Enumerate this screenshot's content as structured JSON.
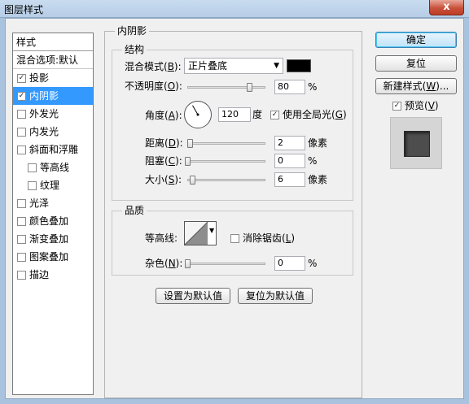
{
  "window": {
    "title": "图层样式",
    "close_label": "x"
  },
  "stylelist": {
    "header": "样式",
    "blend_options": "混合选项:默认",
    "items": [
      {
        "label": "投影",
        "checked": true,
        "selected": false,
        "sub": false
      },
      {
        "label": "内阴影",
        "checked": true,
        "selected": true,
        "sub": false
      },
      {
        "label": "外发光",
        "checked": false,
        "selected": false,
        "sub": false
      },
      {
        "label": "内发光",
        "checked": false,
        "selected": false,
        "sub": false
      },
      {
        "label": "斜面和浮雕",
        "checked": false,
        "selected": false,
        "sub": false
      },
      {
        "label": "等高线",
        "checked": false,
        "selected": false,
        "sub": true
      },
      {
        "label": "纹理",
        "checked": false,
        "selected": false,
        "sub": true
      },
      {
        "label": "光泽",
        "checked": false,
        "selected": false,
        "sub": false
      },
      {
        "label": "颜色叠加",
        "checked": false,
        "selected": false,
        "sub": false
      },
      {
        "label": "渐变叠加",
        "checked": false,
        "selected": false,
        "sub": false
      },
      {
        "label": "图案叠加",
        "checked": false,
        "selected": false,
        "sub": false
      },
      {
        "label": "描边",
        "checked": false,
        "selected": false,
        "sub": false
      }
    ]
  },
  "panel": {
    "title": "内阴影",
    "structure": {
      "title": "结构",
      "blend_mode_label": "混合模式(",
      "blend_mode_key": "B",
      "blend_mode_value": "正片叠底",
      "blend_color": "#000000",
      "opacity_label": "不透明度(",
      "opacity_key": "O",
      "opacity_value": "80",
      "opacity_unit": "%",
      "opacity_level": 0.8,
      "angle_label": "角度(",
      "angle_key": "A",
      "angle_value": "120",
      "angle_unit": "度",
      "angle_degrees": 120,
      "global_light_label": "使用全局光(",
      "global_light_key": "G",
      "global_light_checked": true,
      "distance_label": "距离(",
      "distance_key": "D",
      "distance_value": "2",
      "distance_unit": "像素",
      "choke_label": "阻塞(",
      "choke_key": "C",
      "choke_value": "0",
      "choke_unit": "%",
      "size_label": "大小(",
      "size_key": "S",
      "size_value": "6",
      "size_unit": "像素"
    },
    "quality": {
      "title": "品质",
      "contour_label": "等高线:",
      "antialias_label": "消除锯齿(",
      "antialias_key": "L",
      "antialias_checked": false,
      "noise_label": "杂色(",
      "noise_key": "N",
      "noise_value": "0",
      "noise_unit": "%"
    },
    "set_default_label": "设置为默认值",
    "reset_default_label": "复位为默认值"
  },
  "right": {
    "ok_label": "确定",
    "reset_label": "复位",
    "new_style_label": "新建样式(",
    "new_style_key": "W",
    "new_style_tail": ")...",
    "preview_label": "预览(",
    "preview_key": "V",
    "preview_checked": true
  },
  "common": {
    "close_paren": ")",
    "colon": ":",
    "paren_colon": "):"
  }
}
